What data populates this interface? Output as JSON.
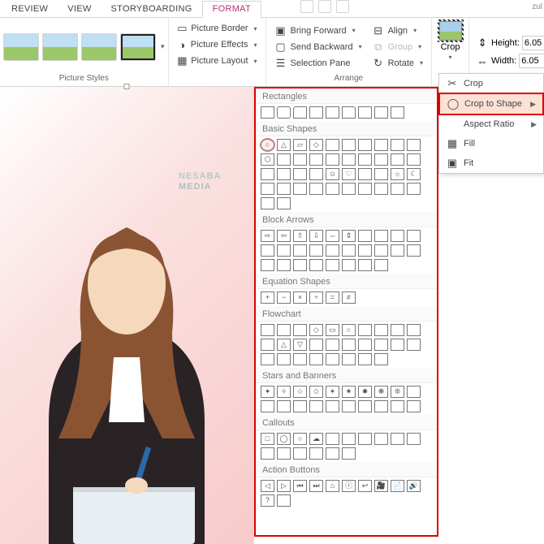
{
  "title_right": "zul",
  "tabs": [
    "REVIEW",
    "VIEW",
    "STORYBOARDING",
    "FORMAT"
  ],
  "active_tab": "FORMAT",
  "groups": {
    "picture_styles": "Picture Styles",
    "arrange": "Arrange"
  },
  "picture_tools": {
    "border": "Picture Border",
    "effects": "Picture Effects",
    "layout": "Picture Layout"
  },
  "arrange": {
    "forward": "Bring Forward",
    "backward": "Send Backward",
    "selpane": "Selection Pane",
    "align": "Align",
    "group": "Group",
    "rotate": "Rotate"
  },
  "crop": {
    "button": "Crop",
    "menu": {
      "crop": "Crop",
      "to_shape": "Crop to Shape",
      "aspect": "Aspect Ratio",
      "fill": "Fill",
      "fit": "Fit"
    }
  },
  "size": {
    "height_label": "Height:",
    "width_label": "Width:",
    "height": "6.05",
    "width": "6.05"
  },
  "watermark": {
    "brand": "NESABA",
    "sub": "MEDIA"
  },
  "shape_categories": {
    "rect": "Rectangles",
    "basic": "Basic Shapes",
    "arrows": "Block Arrows",
    "eq": "Equation Shapes",
    "flow": "Flowchart",
    "stars": "Stars and Banners",
    "call": "Callouts",
    "action": "Action Buttons"
  },
  "shape_counts": {
    "rect": 9,
    "basic": 42,
    "arrows": 28,
    "eq": 6,
    "flow": 28,
    "stars": 20,
    "call": 16,
    "action": 12
  }
}
